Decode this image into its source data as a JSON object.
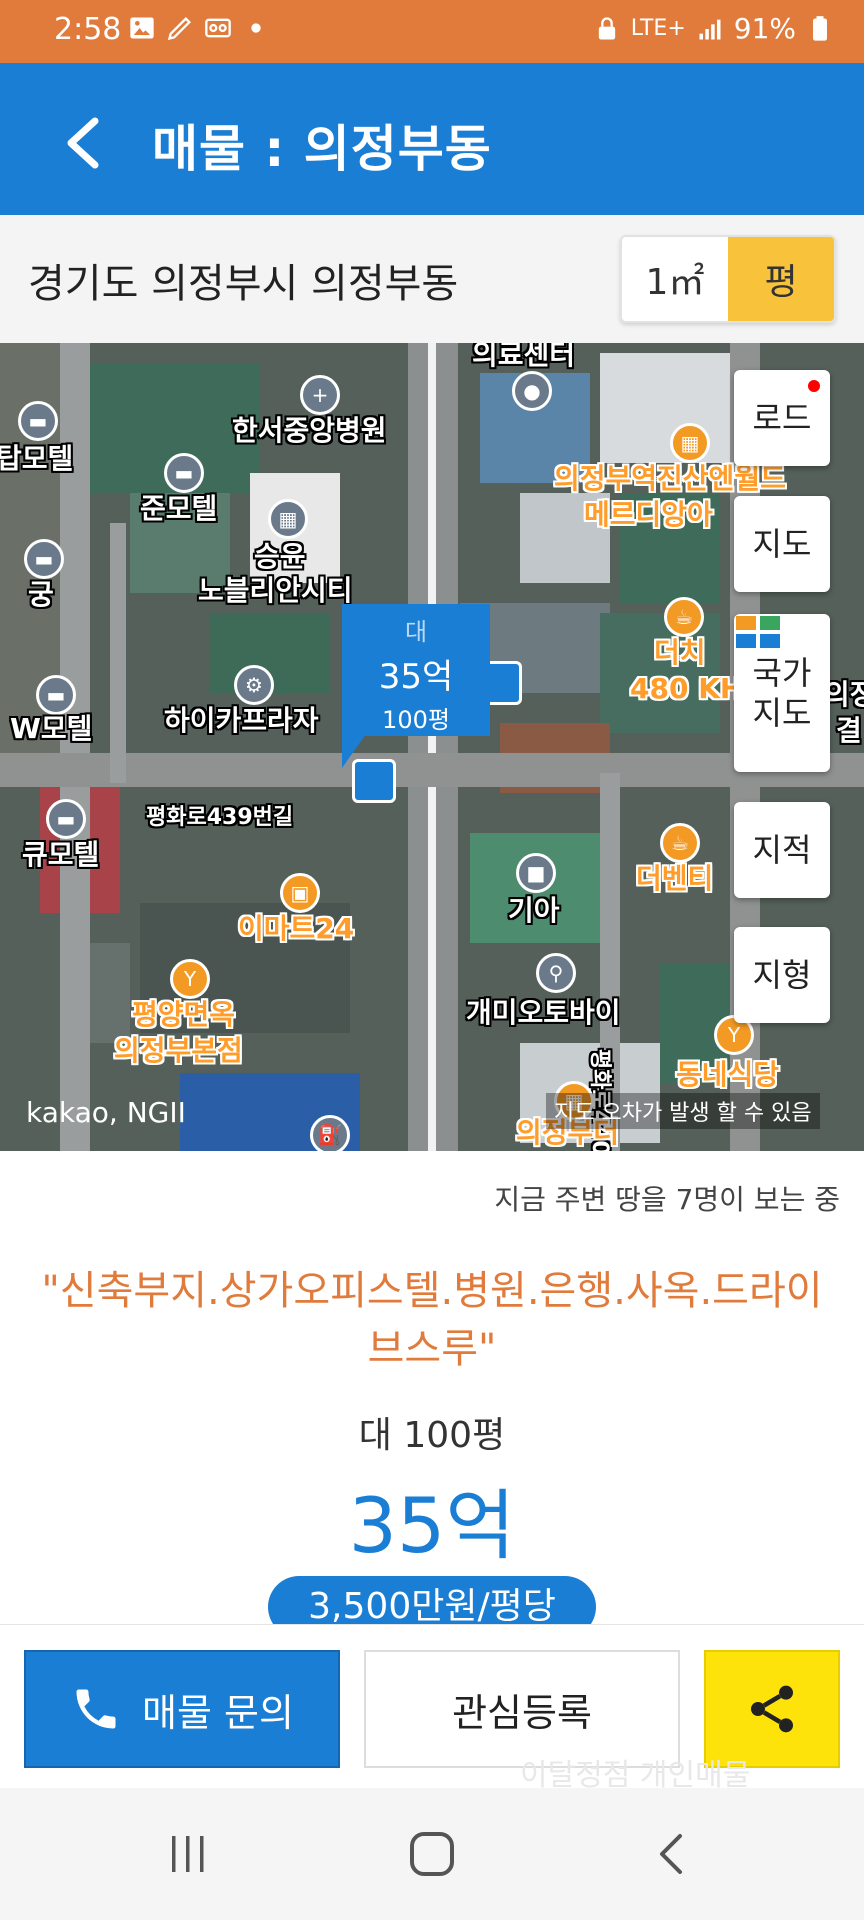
{
  "status_bar": {
    "time": "2:58",
    "network": "LTE+",
    "battery": "91%",
    "icons": [
      "image-icon",
      "pen-icon",
      "voicemail-icon",
      "dot-icon",
      "lock-icon",
      "signal-icon",
      "battery-icon"
    ]
  },
  "app_bar": {
    "title": "매물 : 의정부동",
    "back_icon": "chevron-left-icon"
  },
  "location": {
    "address": "경기도 의정부시 의정부동",
    "unit_options": [
      "1㎡",
      "평"
    ],
    "selected_unit": "평"
  },
  "map": {
    "pois": [
      "의료센터",
      "한서중앙병원",
      "탑모텔",
      "준모텔",
      "승윤",
      "노블리안시티",
      "궁",
      "의정부역진산엔월드",
      "메르디앙아",
      "더치",
      "480 KH",
      "하이카프라자",
      "W모텔",
      "평화로439번길",
      "큐모텔",
      "이마트24",
      "기아",
      "더벤티",
      "개미오토바이",
      "평양면옥",
      "의정부본점",
      "동네식당",
      "평화로440번길",
      "의정부더",
      "의정",
      "결"
    ],
    "marker": {
      "type": "대",
      "price": "35억",
      "area": "100평"
    },
    "side_buttons": [
      "로드",
      "지도",
      "국가\n지도",
      "지적",
      "지형"
    ],
    "credit": "kakao, NGII",
    "warning": "지도 오차가 발생 할 수 있음",
    "colors": {
      "marker": "#1a7ed4",
      "poi_orange": "#ff9c2a"
    }
  },
  "listing": {
    "viewers": "지금 주변 땅을 7명이 보는 중",
    "headline": "\"신축부지.상가오피스텔.병원.은행.사옥.드라이브스루\"",
    "land_area": "대 100평",
    "price": "35억",
    "unit_price": "3,500만원/평당"
  },
  "bottom_bar": {
    "inquiry_label": "매물 문의",
    "favorite_label": "관심등록",
    "share_icon": "share-icon",
    "ghost_text": "이달정점 개인매물"
  },
  "nav_bar": {
    "items": [
      "recent-apps-icon",
      "home-icon",
      "back-icon"
    ]
  }
}
